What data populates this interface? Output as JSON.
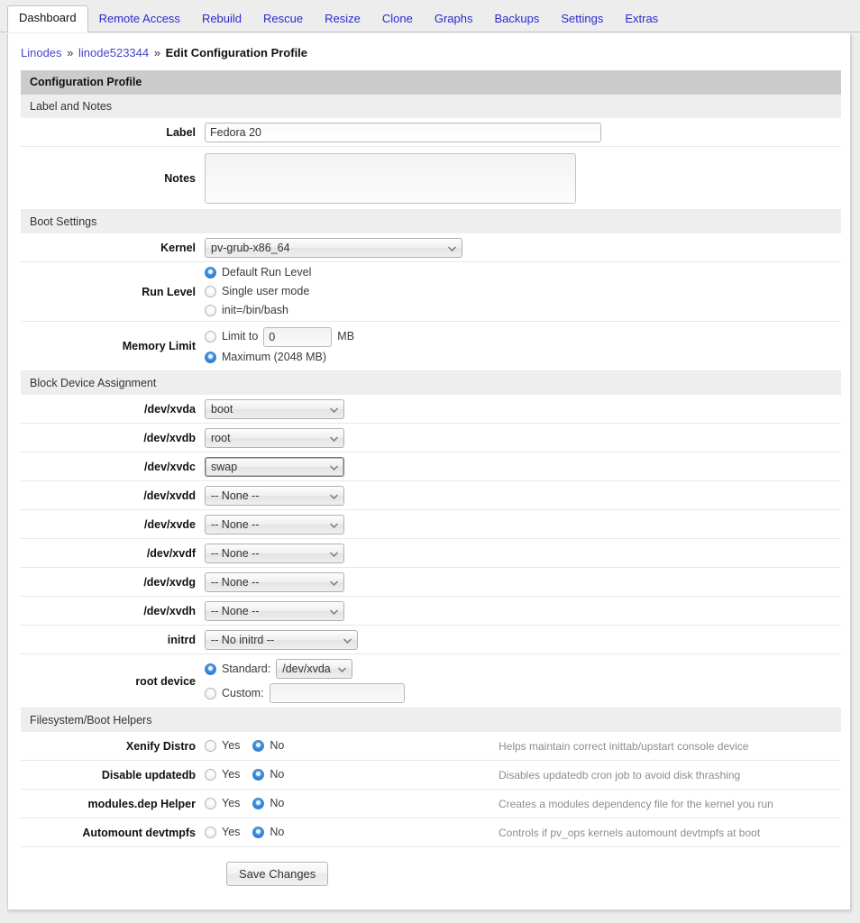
{
  "tabs": [
    {
      "label": "Dashboard",
      "active": true
    },
    {
      "label": "Remote Access",
      "active": false
    },
    {
      "label": "Rebuild",
      "active": false
    },
    {
      "label": "Rescue",
      "active": false
    },
    {
      "label": "Resize",
      "active": false
    },
    {
      "label": "Clone",
      "active": false
    },
    {
      "label": "Graphs",
      "active": false
    },
    {
      "label": "Backups",
      "active": false
    },
    {
      "label": "Settings",
      "active": false
    },
    {
      "label": "Extras",
      "active": false
    }
  ],
  "breadcrumb": {
    "root": "Linodes",
    "sep1": "»",
    "linode": "linode523344",
    "sep2": "»",
    "current": "Edit Configuration Profile"
  },
  "panel": {
    "title": "Configuration Profile"
  },
  "sections": {
    "label_and_notes": "Label and Notes",
    "boot_settings": "Boot Settings",
    "block_device": "Block Device Assignment",
    "fs_boot_helpers": "Filesystem/Boot Helpers"
  },
  "label_field": {
    "label": "Label",
    "value": "Fedora 20",
    "placeholder": ""
  },
  "notes_field": {
    "label": "Notes",
    "value": "",
    "placeholder": ""
  },
  "kernel": {
    "label": "Kernel",
    "value": "pv-grub-x86_64"
  },
  "run_level": {
    "label": "Run Level",
    "options": [
      {
        "label": "Default Run Level",
        "selected": true
      },
      {
        "label": "Single user mode",
        "selected": false
      },
      {
        "label": "init=/bin/bash",
        "selected": false
      }
    ]
  },
  "memory_limit": {
    "label": "Memory Limit",
    "limit_to_label": "Limit to",
    "limit_to_selected": false,
    "limit_value": "0",
    "unit": "MB",
    "maximum_label": "Maximum (2048 MB)",
    "maximum_selected": true
  },
  "block_devices": [
    {
      "label": "/dev/xvda",
      "value": "boot",
      "focused": false
    },
    {
      "label": "/dev/xvdb",
      "value": "root",
      "focused": false
    },
    {
      "label": "/dev/xvdc",
      "value": "swap",
      "focused": true
    },
    {
      "label": "/dev/xvdd",
      "value": "-- None --",
      "focused": false
    },
    {
      "label": "/dev/xvde",
      "value": "-- None --",
      "focused": false
    },
    {
      "label": "/dev/xvdf",
      "value": "-- None --",
      "focused": false
    },
    {
      "label": "/dev/xvdg",
      "value": "-- None --",
      "focused": false
    },
    {
      "label": "/dev/xvdh",
      "value": "-- None --",
      "focused": false
    }
  ],
  "initrd": {
    "label": "initrd",
    "value": "-- No initrd --"
  },
  "root_device": {
    "label": "root device",
    "standard_label": "Standard:",
    "standard_selected": true,
    "standard_value": "/dev/xvda",
    "custom_label": "Custom:",
    "custom_selected": false,
    "custom_value": ""
  },
  "helpers": [
    {
      "label": "Xenify Distro",
      "yes_label": "Yes",
      "no_label": "No",
      "value": "No",
      "help": "Helps maintain correct inittab/upstart console device"
    },
    {
      "label": "Disable updatedb",
      "yes_label": "Yes",
      "no_label": "No",
      "value": "No",
      "help": "Disables updatedb cron job to avoid disk thrashing"
    },
    {
      "label": "modules.dep Helper",
      "yes_label": "Yes",
      "no_label": "No",
      "value": "No",
      "help": "Creates a modules dependency file for the kernel you run"
    },
    {
      "label": "Automount devtmpfs",
      "yes_label": "Yes",
      "no_label": "No",
      "value": "No",
      "help": "Controls if pv_ops kernels automount devtmpfs at boot"
    }
  ],
  "save_button": {
    "label": "Save Changes"
  },
  "colors": {
    "link": "#2a2ad0",
    "panel_header_bg": "#cccccc",
    "section_bg": "#eeeeee",
    "radio_on": "#2f86e0",
    "page_bg": "#ededed"
  }
}
